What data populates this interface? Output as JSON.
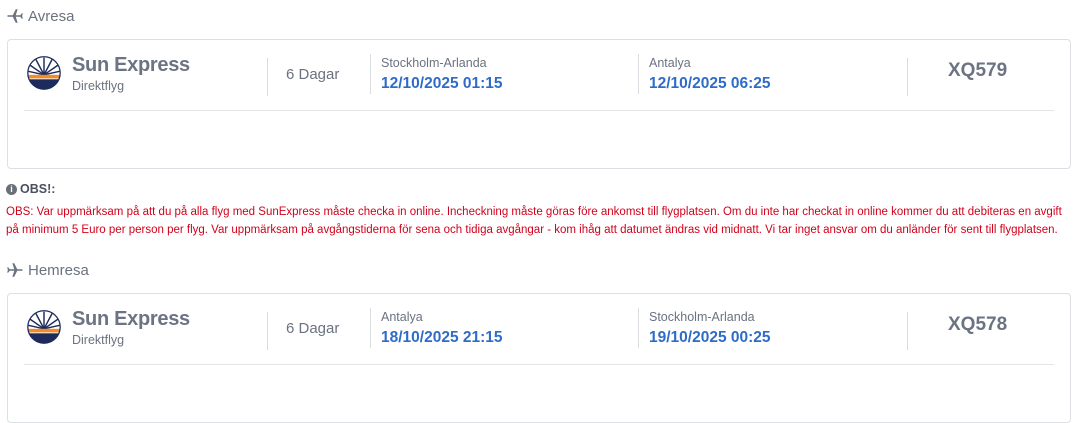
{
  "outbound": {
    "section_label": "Avresa",
    "airline": "Sun Express",
    "flight_type": "Direktflyg",
    "duration": "6 Dagar",
    "departure": {
      "place": "Stockholm-Arlanda",
      "datetime": "12/10/2025 01:15"
    },
    "arrival": {
      "place": "Antalya",
      "datetime": "12/10/2025 06:25"
    },
    "flight_number": "XQ579"
  },
  "notice": {
    "title": "OBS!:",
    "text": "OBS: Var uppmärksam på att du på alla flyg med SunExpress måste checka in online. Incheckning måste göras före ankomst till flygplatsen. Om du inte har checkat in online kommer du att debiteras en avgift på minimum 5 Euro per person per flyg. Var uppmärksam på avgångstiderna för sena och tidiga avgångar - kom ihåg att datumet ändras vid midnatt. Vi tar inget ansvar om du anländer för sent till flygplatsen."
  },
  "return": {
    "section_label": "Hemresa",
    "airline": "Sun Express",
    "flight_type": "Direktflyg",
    "duration": "6 Dagar",
    "departure": {
      "place": "Antalya",
      "datetime": "18/10/2025 21:15"
    },
    "arrival": {
      "place": "Stockholm-Arlanda",
      "datetime": "19/10/2025 00:25"
    },
    "flight_number": "XQ578"
  },
  "colors": {
    "accent": "#2f6cc7",
    "warning": "#d0021b",
    "logo_navy": "#1d2a5c",
    "logo_orange": "#f28c28"
  },
  "icons": {
    "outbound": "plane-departure-icon",
    "return": "plane-arrival-icon",
    "notice": "info-icon",
    "logo": "sunexpress-logo"
  }
}
